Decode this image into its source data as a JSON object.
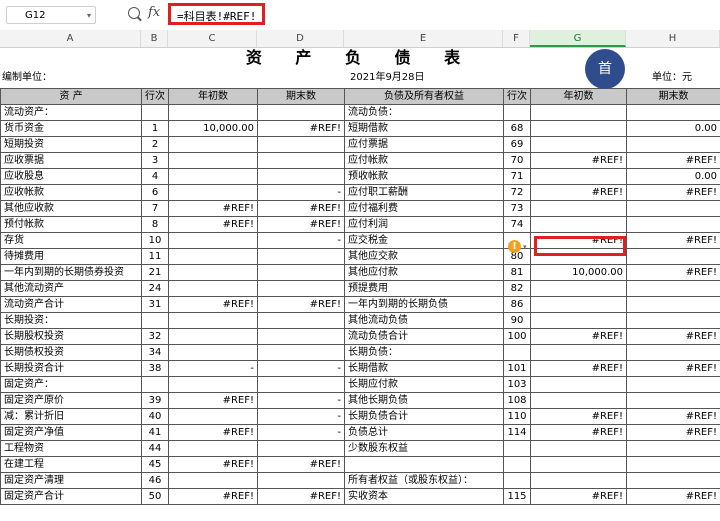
{
  "formula_bar": {
    "name_box": "G12",
    "fx_label": "fx",
    "formula": "=科目表!#REF!"
  },
  "columns": [
    "A",
    "B",
    "C",
    "D",
    "E",
    "F",
    "G",
    "H"
  ],
  "sheet": {
    "title": "资 产 负 债 表",
    "unit_left": "编制单位：",
    "date": "2021年9月28日",
    "unit_right": "单位：元",
    "headers": [
      "资 产",
      "行次",
      "年初数",
      "期末数",
      "负债及所有者权益",
      "行次",
      "年初数",
      "期末数"
    ],
    "rows": [
      [
        "流动资产：",
        "",
        "",
        "",
        "流动负债：",
        "",
        "",
        ""
      ],
      [
        "货币资金",
        "1",
        "10,000.00",
        "#REF!",
        "短期借款",
        "68",
        "",
        "0.00"
      ],
      [
        "短期投资",
        "2",
        "",
        "",
        "应付票据",
        "69",
        "",
        ""
      ],
      [
        "应收票据",
        "3",
        "",
        "",
        "应付帐款",
        "70",
        "#REF!",
        "#REF!"
      ],
      [
        "应收股息",
        "4",
        "",
        "",
        "预收帐款",
        "71",
        "",
        "0.00"
      ],
      [
        "应收帐款",
        "6",
        "",
        "-",
        "应付职工薪酬",
        "72",
        "#REF!",
        "#REF!"
      ],
      [
        "其他应收款",
        "7",
        "#REF!",
        "#REF!",
        "应付福利费",
        "73",
        "",
        ""
      ],
      [
        "预付帐款",
        "8",
        "#REF!",
        "#REF!",
        "应付利润",
        "74",
        "",
        ""
      ],
      [
        "存货",
        "10",
        "",
        "-",
        "应交税金",
        "",
        "#REF!",
        "#REF!"
      ],
      [
        "待摊费用",
        "11",
        "",
        "",
        "其他应交款",
        "80",
        "",
        ""
      ],
      [
        "一年内到期的长期债券投资",
        "21",
        "",
        "",
        "其他应付款",
        "81",
        "10,000.00",
        "#REF!"
      ],
      [
        "其他流动资产",
        "24",
        "",
        "",
        "预提费用",
        "82",
        "",
        ""
      ],
      [
        "流动资产合计",
        "31",
        "#REF!",
        "#REF!",
        "一年内到期的长期负债",
        "86",
        "",
        ""
      ],
      [
        "长期投资：",
        "",
        "",
        "",
        "其他流动负债",
        "90",
        "",
        ""
      ],
      [
        "长期股权投资",
        "32",
        "",
        "",
        "流动负债合计",
        "100",
        "#REF!",
        "#REF!"
      ],
      [
        "长期债权投资",
        "34",
        "",
        "",
        "长期负债：",
        "",
        "",
        ""
      ],
      [
        "长期投资合计",
        "38",
        "-",
        "-",
        "长期借款",
        "101",
        "#REF!",
        "#REF!"
      ],
      [
        "固定资产：",
        "",
        "",
        "",
        "长期应付款",
        "103",
        "",
        ""
      ],
      [
        "固定资产原价",
        "39",
        "#REF!",
        "-",
        "其他长期负债",
        "108",
        "",
        ""
      ],
      [
        "减：累计折旧",
        "40",
        "",
        "-",
        "长期负债合计",
        "110",
        "#REF!",
        "#REF!"
      ],
      [
        "固定资产净值",
        "41",
        "#REF!",
        "-",
        "负债总计",
        "114",
        "#REF!",
        "#REF!"
      ],
      [
        "工程物资",
        "44",
        "",
        "",
        "少数股东权益",
        "",
        "",
        ""
      ],
      [
        "在建工程",
        "45",
        "#REF!",
        "#REF!",
        "",
        "",
        "",
        ""
      ],
      [
        "固定资产清理",
        "46",
        "",
        "",
        "所有者权益（或股东权益）：",
        "",
        "",
        ""
      ],
      [
        "固定资产合计",
        "50",
        "#REF!",
        "#REF!",
        "实收资本",
        "115",
        "#REF!",
        "#REF!"
      ]
    ]
  },
  "avatar_label": "首"
}
